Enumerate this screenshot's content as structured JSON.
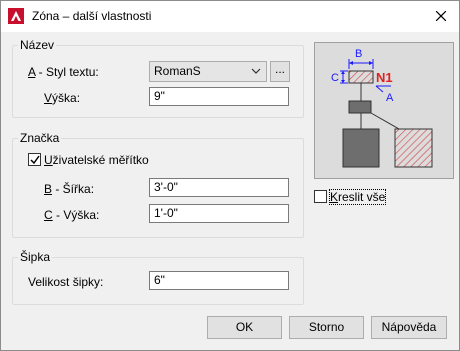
{
  "window": {
    "title": "Zóna – další vlastnosti"
  },
  "nazev": {
    "title": "Název",
    "style_label_key": "A",
    "style_label_rest": " - Styl textu:",
    "style_value": "RomanS",
    "browse_label": "...",
    "height_label_key": "V",
    "height_label_rest": "ýška:",
    "height_value": "9\""
  },
  "znacka": {
    "title": "Značka",
    "user_scale_key": "U",
    "user_scale_rest": "živatelské měřítko",
    "user_scale_checked": true,
    "width_label_key": "B",
    "width_label_rest": " - Šířka:",
    "width_value": "3'-0\"",
    "height_label_key": "C",
    "height_label_rest": " - Výška:",
    "height_value": "1'-0\""
  },
  "sipka": {
    "title": "Šipka",
    "size_label": "Velikost šipky:",
    "size_value": "6\""
  },
  "preview": {
    "label_b": "B",
    "label_c": "C",
    "label_n1": "N1",
    "label_a": "A",
    "colors": {
      "dim": "#1a1aff",
      "tag": "#e02020",
      "hatch": "#d04040",
      "box": "#6e6e6e"
    }
  },
  "draw_all": {
    "key": "K",
    "rest": "reslit vše",
    "checked": false
  },
  "buttons": {
    "ok": "OK",
    "cancel": "Storno",
    "help": "Nápověda"
  }
}
